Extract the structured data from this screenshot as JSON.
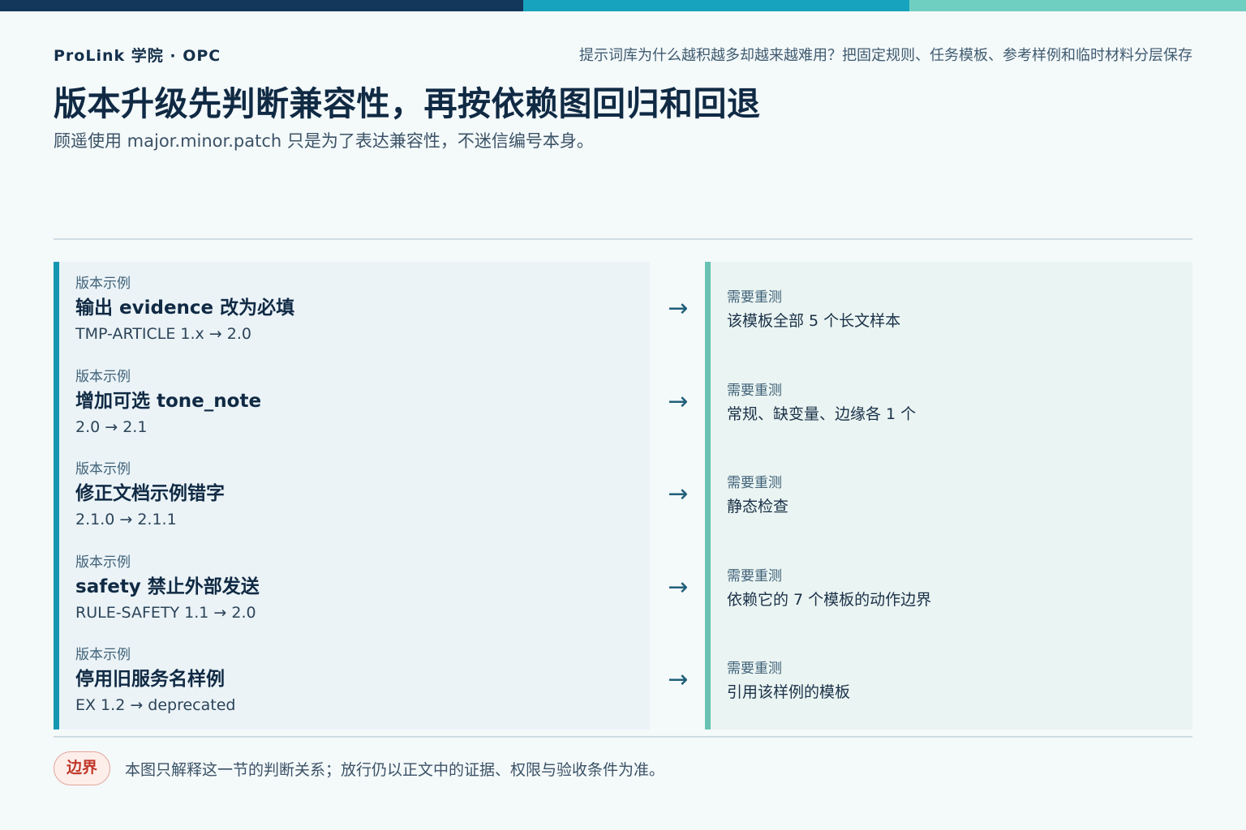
{
  "brand": "ProLink 学院 · OPC",
  "topic": "提示词库为什么越积越多却越来越难用？把固定规则、任务模板、参考样例和临时材料分层保存",
  "title": "版本升级先判断兼容性，再按依赖图回归和回退",
  "subtitle": "顾遥使用 major.minor.patch 只是为了表达兼容性，不迷信编号本身。",
  "arrow": "→",
  "rows": [
    {
      "tag": "版本示例",
      "name": "输出 evidence 改为必填",
      "version": "TMP-ARTICLE 1.x → 2.0",
      "retest_tag": "需要重测",
      "retest": "该模板全部 5 个长文样本"
    },
    {
      "tag": "版本示例",
      "name": "增加可选 tone_note",
      "version": "2.0 → 2.1",
      "retest_tag": "需要重测",
      "retest": "常规、缺变量、边缘各 1 个"
    },
    {
      "tag": "版本示例",
      "name": "修正文档示例错字",
      "version": "2.1.0 → 2.1.1",
      "retest_tag": "需要重测",
      "retest": "静态检查"
    },
    {
      "tag": "版本示例",
      "name": "safety 禁止外部发送",
      "version": "RULE-SAFETY 1.1 → 2.0",
      "retest_tag": "需要重测",
      "retest": "依赖它的 7 个模板的动作边界"
    },
    {
      "tag": "版本示例",
      "name": "停用旧服务名样例",
      "version": "EX 1.2 → deprecated",
      "retest_tag": "需要重测",
      "retest": "引用该样例的模板"
    }
  ],
  "boundary": {
    "badge": "边界",
    "note": "本图只解释这一节的判断关系；放行仍以正文中的证据、权限与验收条件为准。"
  }
}
